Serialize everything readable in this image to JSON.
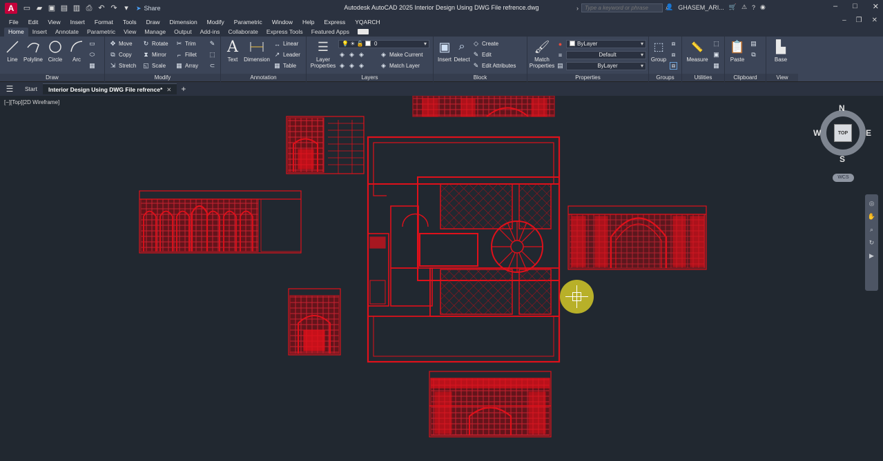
{
  "app": {
    "title": "Autodesk AutoCAD 2025    Interior Design Using DWG File refrence.dwg",
    "logo": "A",
    "share_label": "Share",
    "search_placeholder": "Type a keyword or phrase",
    "user": "GHASEM_ARI..."
  },
  "menu": [
    "File",
    "Edit",
    "View",
    "Insert",
    "Format",
    "Tools",
    "Draw",
    "Dimension",
    "Modify",
    "Parametric",
    "Window",
    "Help",
    "Express",
    "YQARCH"
  ],
  "ribbon_tabs": [
    "Home",
    "Insert",
    "Annotate",
    "Parametric",
    "View",
    "Manage",
    "Output",
    "Add-ins",
    "Collaborate",
    "Express Tools",
    "Featured Apps"
  ],
  "ribbon": {
    "draw": {
      "title": "Draw",
      "line": "Line",
      "polyline": "Polyline",
      "circle": "Circle",
      "arc": "Arc"
    },
    "modify": {
      "title": "Modify",
      "move": "Move",
      "rotate": "Rotate",
      "trim": "Trim",
      "copy": "Copy",
      "mirror": "Mirror",
      "fillet": "Fillet",
      "stretch": "Stretch",
      "scale": "Scale",
      "array": "Array"
    },
    "annotation": {
      "title": "Annotation",
      "text": "Text",
      "dimension": "Dimension",
      "linear": "Linear",
      "leader": "Leader",
      "table": "Table"
    },
    "layers": {
      "title": "Layers",
      "layer_properties_1": "Layer",
      "layer_properties_2": "Properties",
      "current_layer": "0",
      "make_current": "Make Current",
      "match_layer": "Match Layer"
    },
    "block": {
      "title": "Block",
      "insert": "Insert",
      "detect": "Detect",
      "create": "Create",
      "edit": "Edit",
      "edit_attributes": "Edit Attributes"
    },
    "properties": {
      "title": "Properties",
      "match_1": "Match",
      "match_2": "Properties",
      "color": "ByLayer",
      "linetype": "Default",
      "lineweight": "ByLayer"
    },
    "groups": {
      "title": "Groups",
      "group": "Group"
    },
    "utilities": {
      "title": "Utilities",
      "measure": "Measure"
    },
    "clipboard": {
      "title": "Clipboard",
      "paste": "Paste"
    },
    "view": {
      "title": "View",
      "base": "Base"
    }
  },
  "file_tabs": {
    "start": "Start",
    "active": "Interior Design Using DWG File refrence*"
  },
  "viewport": {
    "label": "[−][Top][2D Wireframe]"
  },
  "viewcube": {
    "top": "TOP",
    "n": "N",
    "s": "S",
    "e": "E",
    "w": "W",
    "wcs": "WCS"
  },
  "colors": {
    "drawing": "#e0101a",
    "background": "#212830",
    "ribbon": "#3c4558",
    "cursor": "#d2c828"
  }
}
